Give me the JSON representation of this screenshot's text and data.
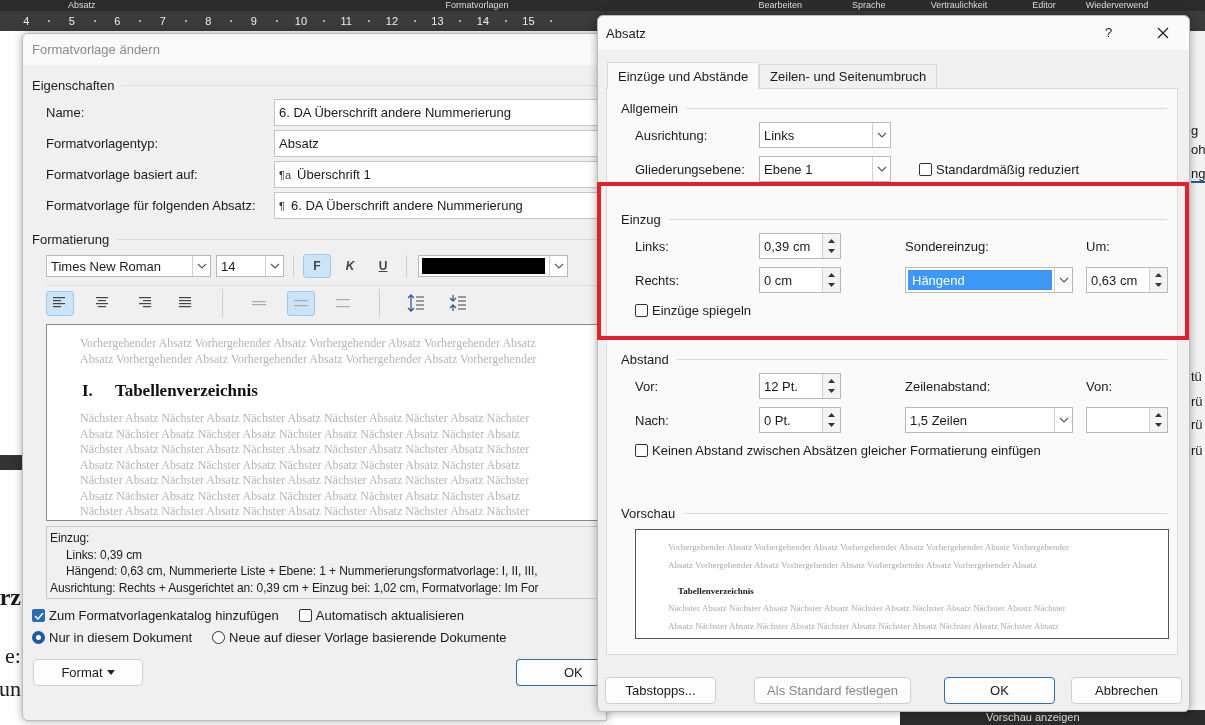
{
  "ribbon": {
    "groups": [
      "Absatz",
      "Formatvorlagen",
      "Bearbeiten",
      "Sprache",
      "Vertraulichkeit",
      "Editor",
      "Wiederverwend"
    ]
  },
  "ruler": {
    "numbers": [
      "4",
      "5",
      "6",
      "7",
      "8",
      "9",
      "10",
      "11",
      "12",
      "13",
      "14",
      "15"
    ]
  },
  "document": {
    "left_fragments": [
      "rz",
      "e:",
      "un"
    ],
    "right_fragments": [
      "g",
      "oh",
      "ng",
      "tü",
      "rü",
      "rü",
      "rü"
    ],
    "bottom_bar": "Vorschau anzeigen"
  },
  "style_dialog": {
    "title": "Formatvorlage ändern",
    "active": false,
    "properties": {
      "heading": "Eigenschaften",
      "rows": [
        {
          "label": "Name:",
          "value": "6. DA Überschrift andere Nummerierung"
        },
        {
          "label": "Formatvorlagentyp:",
          "value": "Absatz"
        },
        {
          "label": "Formatvorlage basiert auf:",
          "symbol": "¶a",
          "value": "Überschrift 1"
        },
        {
          "label": "Formatvorlage für folgenden Absatz:",
          "symbol": "¶",
          "value": "6. DA Überschrift andere Nummerierung"
        }
      ]
    },
    "formatting": {
      "heading": "Formatierung",
      "font": "Times New Roman",
      "size": "14",
      "color": "#000000",
      "styles": [
        {
          "label": "F",
          "kind": "bold",
          "selected": true
        },
        {
          "label": "K",
          "kind": "italic",
          "selected": false
        },
        {
          "label": "U",
          "kind": "underline",
          "selected": false
        }
      ],
      "alignment": [
        {
          "kind": "left",
          "selected": true
        },
        {
          "kind": "center",
          "selected": false
        },
        {
          "kind": "right",
          "selected": false
        },
        {
          "kind": "justify",
          "selected": false
        }
      ],
      "line_spacing": [
        {
          "kind": "single",
          "selected": false
        },
        {
          "kind": "one_half",
          "selected": true
        },
        {
          "kind": "double",
          "selected": false
        }
      ],
      "paragraph_spacing": [
        {
          "kind": "increase"
        },
        {
          "kind": "decrease"
        }
      ]
    },
    "preview": {
      "before": [
        "Vorhergehender Absatz Vorhergehender Absatz Vorhergehender Absatz Vorhergehender Absatz",
        "Absatz Vorhergehender Absatz Vorhergehender Absatz Vorhergehender Absatz Vorhergehender"
      ],
      "number": "I.",
      "heading": "Tabellenverzeichnis",
      "after": [
        "Nächster Absatz Nächster Absatz Nächster Absatz Nächster Absatz Nächster Absatz Nächster",
        "Absatz Nächster Absatz Nächster Absatz Nächster Absatz Nächster Absatz Nächster Absatz",
        "Nächster Absatz Nächster Absatz Nächster Absatz Nächster Absatz Nächster Absatz Nächster",
        "Absatz Nächster Absatz Nächster Absatz Nächster Absatz Nächster Absatz Nächster Absatz",
        "Nächster Absatz Nächster Absatz Nächster Absatz Nächster Absatz Nächster Absatz Nächster",
        "Absatz Nächster Absatz Nächster Absatz Nächster Absatz Nächster Absatz Nächster Absatz",
        "Nächster Absatz Nächster Absatz Nächster Absatz Nächster Absatz Nächster Absatz Nächster"
      ]
    },
    "description": [
      {
        "text": "Einzug:",
        "indented": false
      },
      {
        "text": "Links:  0,39 cm",
        "indented": true
      },
      {
        "text": "Hängend:  0,63 cm, Nummerierte Liste + Ebene: 1 + Nummerierungsformatvorlage: I, II, III,",
        "indented": true
      },
      {
        "text": "Ausrichtung: Rechts + Ausgerichtet an:  0,39 cm + Einzug bei:  1,02 cm, Formatvorlage: Im For",
        "indented": false
      }
    ],
    "checkboxes": [
      {
        "label": "Zum Formatvorlagenkatalog hinzufügen",
        "checked": true
      },
      {
        "label": "Automatisch aktualisieren",
        "checked": false
      }
    ],
    "radios": [
      {
        "label": "Nur in diesem Dokument",
        "selected": true
      },
      {
        "label": "Neue auf dieser Vorlage basierende Dokumente",
        "selected": false
      }
    ],
    "buttons": [
      {
        "label": "Format",
        "kind": "menu"
      },
      {
        "label": "OK",
        "kind": "default"
      }
    ]
  },
  "paragraph_dialog": {
    "title": "Absatz",
    "help": "?",
    "tabs": [
      {
        "label": "Einzüge und Abstände",
        "selected": true
      },
      {
        "label": "Zeilen- und Seitenumbruch",
        "selected": false
      }
    ],
    "general": {
      "heading": "Allgemein",
      "alignment": {
        "label": "Ausrichtung:",
        "value": "Links"
      },
      "outline_level": {
        "label": "Gliederungsebene:",
        "value": "Ebene 1"
      },
      "collapsed": {
        "label": "Standardmäßig reduziert",
        "checked": false
      }
    },
    "indentation": {
      "heading": "Einzug",
      "highlighted": true,
      "left": {
        "label": "Links:",
        "value": "0,39 cm"
      },
      "right": {
        "label": "Rechts:",
        "value": "0 cm"
      },
      "special": {
        "label": "Sondereinzug:",
        "value": "Hängend",
        "selected": true
      },
      "by": {
        "label": "Um:",
        "value": "0,63 cm"
      },
      "mirror": {
        "label": "Einzüge spiegeln",
        "checked": false
      }
    },
    "spacing": {
      "heading": "Abstand",
      "before": {
        "label": "Vor:",
        "value": "12 Pt."
      },
      "after": {
        "label": "Nach:",
        "value": "0 Pt."
      },
      "line_spacing": {
        "label": "Zeilenabstand:",
        "value": "1,5 Zeilen"
      },
      "at": {
        "label": "Von:"
      },
      "no_space": {
        "label": "Keinen Abstand zwischen Absätzen gleicher Formatierung einfügen",
        "checked": false
      }
    },
    "preview": {
      "heading": "Vorschau",
      "before": [
        "Vorhergehender Absatz Vorhergehender Absatz Vorhergehender Absatz Vorhergehender Absatz Vorhergehender",
        "Absatz Vorhergehender Absatz Vorhergehender Absatz Vorhergehender Absatz Vorhergehender Absatz"
      ],
      "heading_text": "Tabellenverzeichnis",
      "after": [
        "Nächster Absatz Nächster Absatz Nächster Absatz Nächster Absatz Nächster Absatz Nächster Absatz Nächster",
        "Absatz Nächster Absatz Nächster Absatz Nächster Absatz Nächster Absatz Nächster Absatz Nächster Absatz"
      ]
    },
    "buttons": [
      {
        "label": "Tabstopps...",
        "disabled": false,
        "default": false
      },
      {
        "label": "Als Standard festlegen",
        "disabled": true,
        "default": false
      },
      {
        "label": "OK",
        "disabled": false,
        "default": true
      },
      {
        "label": "Abbrechen",
        "disabled": false,
        "default": false
      }
    ]
  }
}
